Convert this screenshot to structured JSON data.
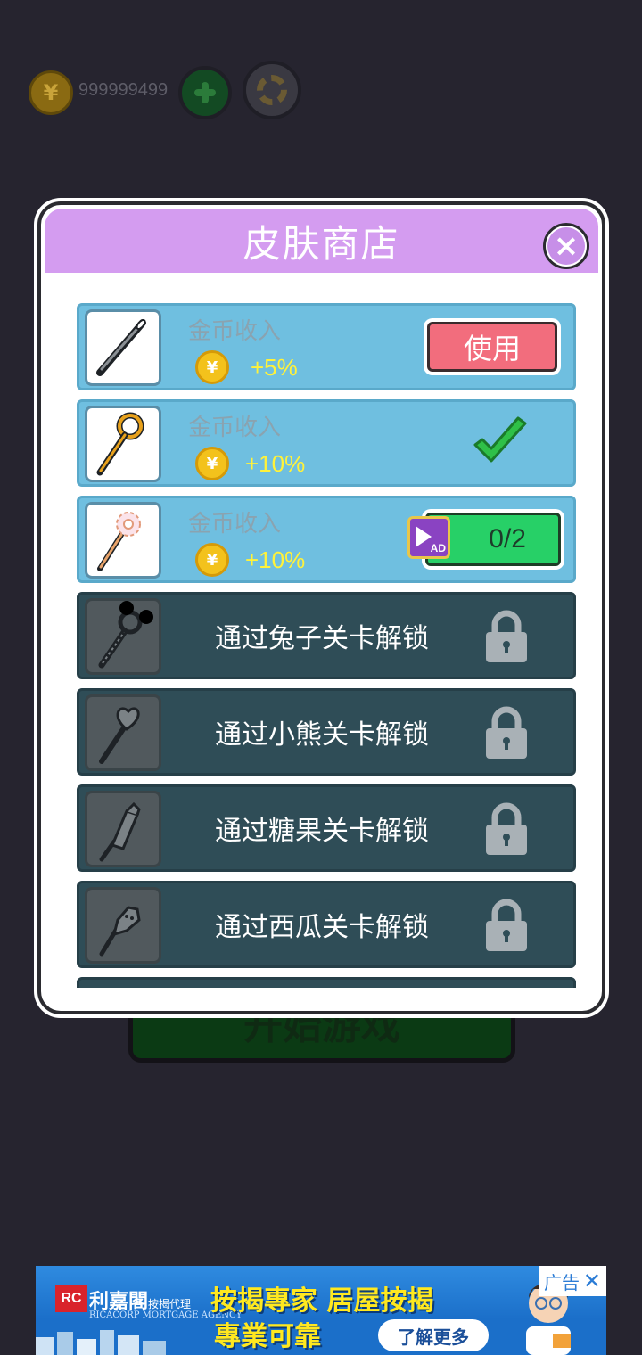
{
  "background": {
    "coin_symbol": "¥",
    "coin_count": "999999499",
    "start_button_label": "开始游戏"
  },
  "modal": {
    "title": "皮肤商店",
    "close_symbol": "×"
  },
  "skins": [
    {
      "income_label": "金币收入",
      "coin_symbol": "¥",
      "bonus": "+5%",
      "action": "use",
      "action_label": "使用"
    },
    {
      "income_label": "金币收入",
      "coin_symbol": "¥",
      "bonus": "+10%",
      "action": "equipped"
    },
    {
      "income_label": "金币收入",
      "coin_symbol": "¥",
      "bonus": "+10%",
      "action": "ad",
      "ad_progress": "0/2",
      "ad_badge": "AD"
    },
    {
      "unlock_text": "通过兔子关卡解锁",
      "locked": true
    },
    {
      "unlock_text": "通过小熊关卡解锁",
      "locked": true
    },
    {
      "unlock_text": "通过糖果关卡解锁",
      "locked": true
    },
    {
      "unlock_text": "通过西瓜关卡解锁",
      "locked": true
    }
  ],
  "ad_banner": {
    "logo": "RC",
    "brand": "利嘉閣",
    "brand_suffix": "按揭代理",
    "brand_sub": "RICACORP MORTGAGE AGENCY",
    "headline_1": "按揭專家 居屋按揭",
    "headline_2": "專業可靠",
    "cta": "了解更多",
    "tag": "广告",
    "close": "✕"
  },
  "colors": {
    "backdrop": "#26242f",
    "header": "#d49cf0",
    "row_unlocked": "#6fbfe0",
    "row_locked": "#2f4d57",
    "use_button": "#f26d7d",
    "ad_button": "#27d067",
    "bonus_text": "#fff23a"
  }
}
